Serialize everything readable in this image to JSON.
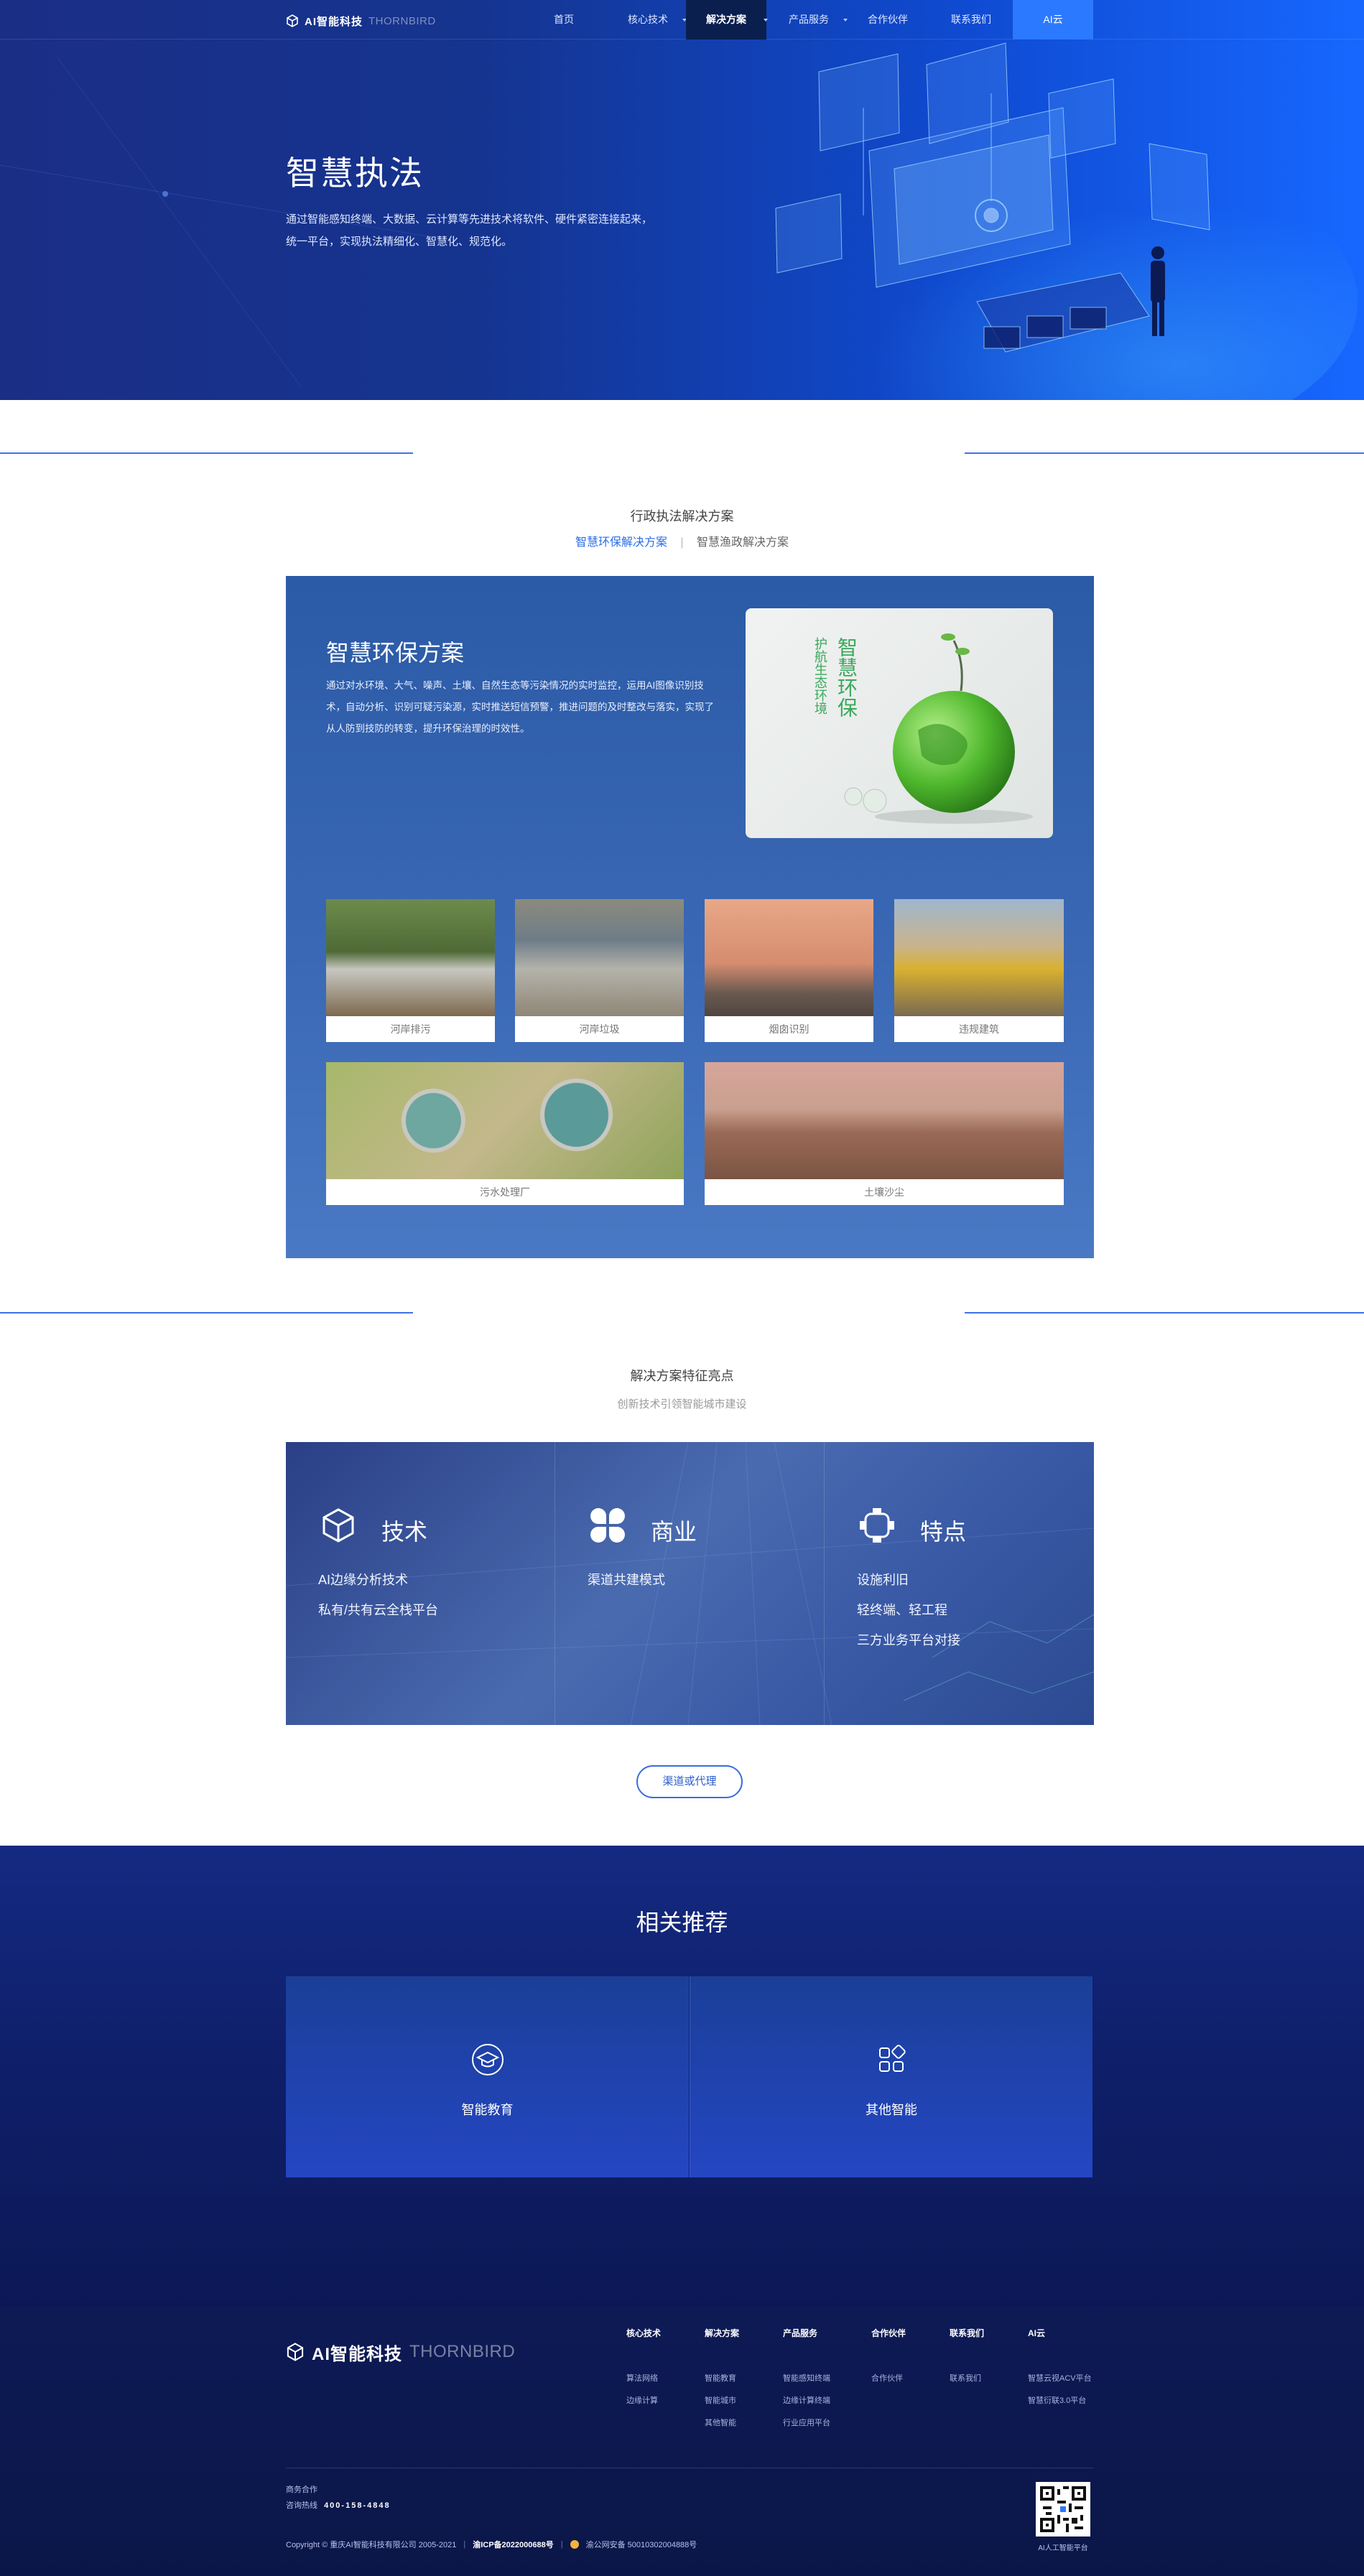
{
  "nav": {
    "logo_main": "AI智能科技",
    "logo_sub": "THORNBIRD",
    "items": [
      {
        "label": "首页"
      },
      {
        "label": "核心技术"
      },
      {
        "label": "解决方案"
      },
      {
        "label": "产品服务"
      },
      {
        "label": "合作伙伴"
      },
      {
        "label": "联系我们"
      },
      {
        "label": "AI云"
      }
    ]
  },
  "hero": {
    "title": "智慧执法",
    "desc": "通过智能感知终端、大数据、云计算等先进技术将软件、硬件紧密连接起来，统一平台，实现执法精细化、智慧化、规范化。"
  },
  "solutions": {
    "section_title": "行政执法解决方案",
    "tab_active": "智慧环保解决方案",
    "tab_sep": "|",
    "tab_other": "智慧渔政解决方案",
    "panel_title": "智慧环保方案",
    "panel_desc": "通过对水环境、大气、噪声、土壤、自然生态等污染情况的实时监控，运用AI图像识别技术，自动分析、识别可疑污染源，实时推送短信预警，推进问题的及时整改与落实，实现了从人防到技防的转变，提升环保治理的时效性。",
    "poster_big": "智慧环保",
    "poster_small": "护航生态环境",
    "cases": [
      {
        "label": "河岸排污"
      },
      {
        "label": "河岸垃圾"
      },
      {
        "label": "烟囱识别"
      },
      {
        "label": "违规建筑"
      },
      {
        "label": "污水处理厂"
      },
      {
        "label": "土壤沙尘"
      }
    ]
  },
  "features": {
    "section_title": "解决方案特征亮点",
    "subtitle": "创新技术引领智能城市建设",
    "columns": [
      {
        "title": "技术",
        "icon": "cube-icon",
        "items": [
          "AI边缘分析技术",
          "私有/共有云全栈平台"
        ]
      },
      {
        "title": "商业",
        "icon": "clover-icon",
        "items": [
          "渠道共建模式"
        ]
      },
      {
        "title": "特点",
        "icon": "frame-icon",
        "items": [
          "设施利旧",
          "轻终端、轻工程",
          "三方业务平台对接"
        ]
      }
    ],
    "button": "渠道或代理"
  },
  "related": {
    "title": "相关推荐",
    "cards": [
      {
        "label": "智能教育",
        "icon": "graduation-cap-icon"
      },
      {
        "label": "其他智能",
        "icon": "grid-icon"
      }
    ]
  },
  "footer": {
    "logo_main": "AI智能科技",
    "logo_sub": "THORNBIRD",
    "columns": [
      {
        "heading": "核心技术",
        "links": [
          "算法网络",
          "边缘计算"
        ]
      },
      {
        "heading": "解决方案",
        "links": [
          "智能教育",
          "智能城市",
          "其他智能"
        ]
      },
      {
        "heading": "产品服务",
        "links": [
          "智能感知终端",
          "边缘计算终端",
          "行业应用平台"
        ]
      },
      {
        "heading": "合作伙伴",
        "links": [
          "合作伙伴"
        ]
      },
      {
        "heading": "联系我们",
        "links": [
          "联系我们"
        ]
      },
      {
        "heading": "AI云",
        "links": [
          "智慧云视ACV平台",
          "智慧衍联3.0平台"
        ]
      }
    ],
    "business_label": "商务合作",
    "hotline_label": "咨询热线",
    "hotline": "400-158-4848",
    "copyright": "Copyright © 重庆AI智能科技有限公司 2005-2021",
    "icp": "渝ICP备2022000688号",
    "police": "渝公网安备 50010302004888号",
    "qr_caption": "AI人工智能平台"
  },
  "colors": {
    "brand_blue": "#2b79ff",
    "nav_active_bg": "#0b1f4f",
    "accent_text": "#2b6de8",
    "footer_bg": "#0c1a55"
  }
}
